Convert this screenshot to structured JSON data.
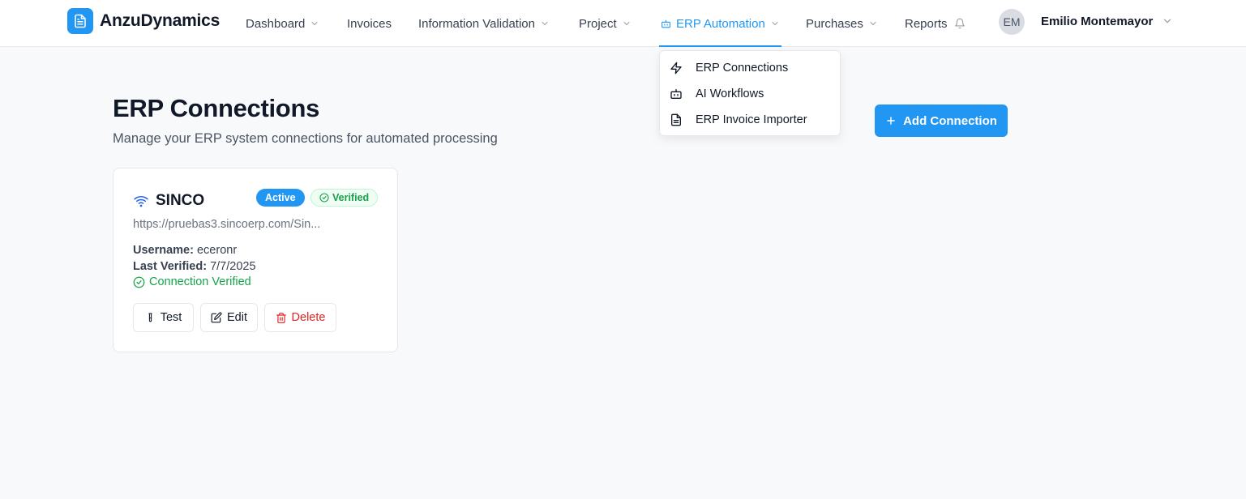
{
  "brand": {
    "name": "AnzuDynamics"
  },
  "nav": {
    "dashboard": "Dashboard",
    "invoices": "Invoices",
    "information_validation": "Information Validation",
    "project": "Project",
    "erp_automation": "ERP Automation",
    "purchases": "Purchases",
    "reports": "Reports"
  },
  "user": {
    "initials": "EM",
    "name": "Emilio Montemayor"
  },
  "dropdown": {
    "items": [
      {
        "label": "ERP Connections",
        "icon": "zap-icon"
      },
      {
        "label": "AI Workflows",
        "icon": "bot-icon"
      },
      {
        "label": "ERP Invoice Importer",
        "icon": "file-text-icon"
      }
    ]
  },
  "page": {
    "title": "ERP Connections",
    "subtitle": "Manage your ERP system connections for automated processing",
    "add_button": "Add Connection"
  },
  "connection": {
    "name": "SINCO",
    "status_badge": "Active",
    "verified_badge": "Verified",
    "url": "https://pruebas3.sincoerp.com/Sin...",
    "username_label": "Username:",
    "username": "eceronr",
    "last_verified_label": "Last Verified:",
    "last_verified": "7/7/2025",
    "connection_status": "Connection Verified",
    "test_button": "Test",
    "edit_button": "Edit",
    "delete_button": "Delete"
  },
  "colors": {
    "accent": "#2196f3",
    "success": "#16a34a",
    "danger": "#dc2626"
  }
}
